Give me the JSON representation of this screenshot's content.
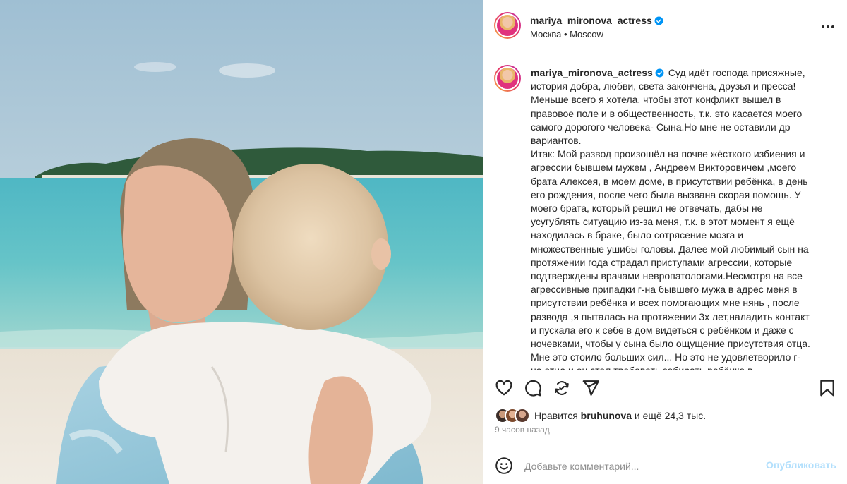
{
  "post": {
    "username": "mariya_mironova_actress",
    "verified": true,
    "location": "Москва • Moscow",
    "caption": "Суд идёт господа присяжные, история добра, любви, света закончена, друзья и пресса!\nМеньше всего я хотела, чтобы этот конфликт вышел в правовое поле и в общественность, т.к. это касается моего самого дорогого человека- Сына.Но мне не оставили др вариантов.\nИтак: Мой развод произошёл на почве жёсткого избиения и агрессии бывшем мужем , Андреем Викторовичем ,моего брата Алексея, в моем доме, в присутствии ребёнка, в день его рождения, после чего была вызвана скорая помощь. У моего брата, который решил не отвечать, дабы не усугублять ситуацию из-за меня, т.к. в этот момент я ещё находилась в браке, было сотрясение мозга и множественные ушибы головы. Далее мой любимый сын на протяжении года страдал приступами агрессии, которые подтверждены врачами невропатологами.Несмотря на все агрессивные припадки г-на бывшего мужа в адрес меня в присутствии ребёнка и всех помогающих мне нянь , после развода ,я пыталась на протяжении 3х лет,наладить контакт и пускала его к себе в дом видеться с ребёнком и даже с ночевками, чтобы у сына было ощущение присутствия отца. Мне это стоило больших сил... Но это не удовлетворило г- на отца и он стал требовать забирать ребёнка в коммунальные и",
    "likes": {
      "prefix": "Нравится",
      "user": "bruhunova",
      "suffix": "и ещё 24,3 тыс."
    },
    "time_ago": "9 часов назад"
  },
  "comment": {
    "placeholder": "Добавьте комментарий...",
    "publish_label": "Опубликовать"
  },
  "icons": {
    "more": "more-options-icon",
    "like": "heart-icon",
    "comment": "comment-icon",
    "repost": "repost-icon",
    "share": "share-icon",
    "save": "bookmark-icon",
    "emoji": "emoji-icon",
    "verified": "verified-badge-icon"
  },
  "colors": {
    "verified": "#0095f6",
    "link_disabled": "#b2dffc",
    "muted": "#8e8e8e",
    "border": "#dbdbdb"
  }
}
